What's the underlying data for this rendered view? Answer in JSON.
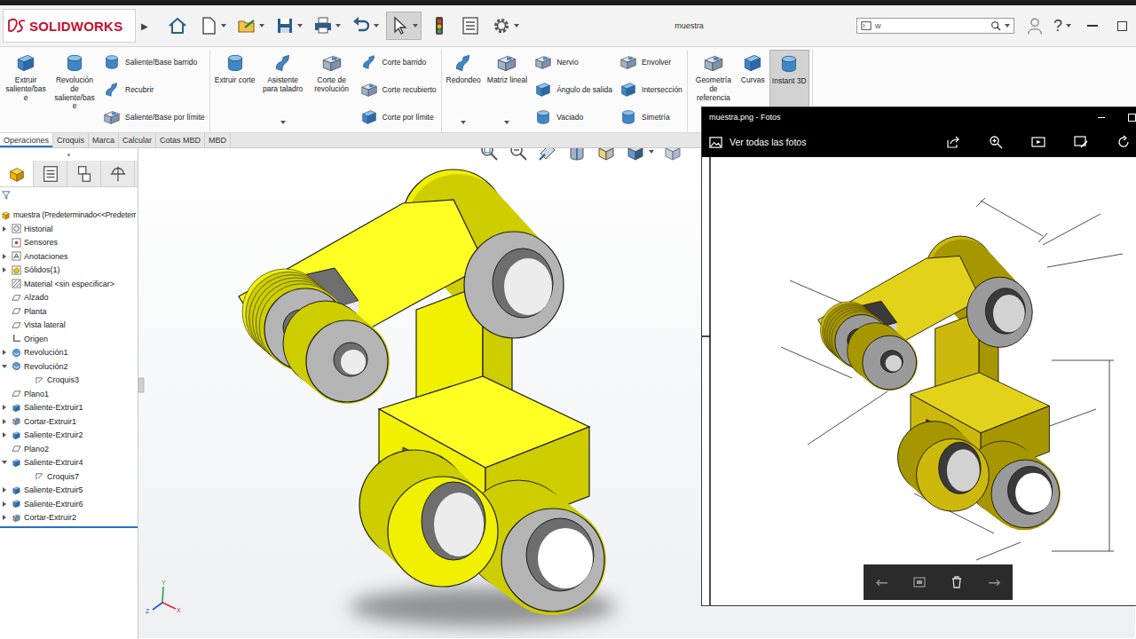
{
  "window": {
    "title": "muestra",
    "brand": "SOLIDWORKS",
    "menu_arrow": "▶"
  },
  "quick_access": [
    {
      "selected": false
    },
    {
      "selected": false
    },
    {
      "selected": false
    },
    {
      "selected": false
    },
    {
      "selected": false
    },
    {
      "selected": false
    },
    {
      "selected": true
    },
    {
      "selected": false
    },
    {
      "selected": false
    },
    {
      "selected": false
    }
  ],
  "search": {
    "value": "w"
  },
  "help": "?",
  "ribbon": {
    "groups": [
      {
        "items": [
          {
            "kind": "large",
            "label": "Extruir saliente/base",
            "selected": false,
            "dropdown": false
          },
          {
            "kind": "large",
            "label": "Revolución de saliente/base",
            "selected": false,
            "dropdown": false
          },
          {
            "kind": "stack",
            "buttons": [
              {
                "label": "Saliente/Base barrido",
                "selected": false
              },
              {
                "label": "Recubrir",
                "selected": false
              },
              {
                "label": "Saliente/Base por límite",
                "selected": false
              }
            ]
          }
        ]
      },
      {
        "items": [
          {
            "kind": "large",
            "label": "Extruir corte",
            "selected": false,
            "dropdown": false
          },
          {
            "kind": "large",
            "label": "Asistente para taladro",
            "selected": false,
            "dropdown": true
          },
          {
            "kind": "large",
            "label": "Corte de revolución",
            "selected": false,
            "dropdown": false
          },
          {
            "kind": "stack",
            "buttons": [
              {
                "label": "Corte barrido",
                "selected": false
              },
              {
                "label": "Corte recubierto",
                "selected": false
              },
              {
                "label": "Corte por límite",
                "selected": false
              }
            ]
          }
        ]
      },
      {
        "items": [
          {
            "kind": "large",
            "label": "Redondeo",
            "selected": false,
            "dropdown": true
          },
          {
            "kind": "large",
            "label": "Matriz lineal",
            "selected": false,
            "dropdown": true
          },
          {
            "kind": "stack",
            "buttons": [
              {
                "label": "Nervio",
                "selected": false
              },
              {
                "label": "Ángulo de salida",
                "selected": false
              },
              {
                "label": "Vaciado",
                "selected": false
              }
            ]
          },
          {
            "kind": "stack",
            "buttons": [
              {
                "label": "Envolver",
                "selected": false
              },
              {
                "label": "Intersección",
                "selected": false
              },
              {
                "label": "Simetría",
                "selected": false
              }
            ]
          }
        ]
      },
      {
        "items": [
          {
            "kind": "large",
            "label": "Geometría de referencia",
            "selected": false,
            "dropdown": true
          },
          {
            "kind": "large",
            "label": "Curvas",
            "selected": false,
            "dropdown": false
          },
          {
            "kind": "large",
            "label": "Instant 3D",
            "selected": true,
            "dropdown": false
          }
        ]
      }
    ]
  },
  "command_tabs": [
    {
      "label": "Operaciones",
      "selected": true
    },
    {
      "label": "Croquis",
      "selected": false
    },
    {
      "label": "Marca",
      "selected": false
    },
    {
      "label": "Calcular",
      "selected": false
    },
    {
      "label": "Cotas MBD",
      "selected": false
    },
    {
      "label": "MBD",
      "selected": false
    }
  ],
  "feature_tabs": [
    {
      "selected": true
    },
    {
      "selected": false
    },
    {
      "selected": false
    },
    {
      "selected": false
    }
  ],
  "tree": {
    "root": "muestra  (Predeterminado<<Predeterr",
    "items": [
      {
        "label": "Historial",
        "kind": "history",
        "expandable": true,
        "expanded": false,
        "indented": false
      },
      {
        "label": "Sensores",
        "kind": "sensor",
        "expandable": false,
        "expanded": false,
        "indented": false
      },
      {
        "label": "Anotaciones",
        "kind": "annotation",
        "expandable": true,
        "expanded": false,
        "indented": false
      },
      {
        "label": "Sólidos(1)",
        "kind": "solids",
        "expandable": true,
        "expanded": false,
        "indented": false
      },
      {
        "label": "Material <sin especificar>",
        "kind": "material",
        "expandable": false,
        "expanded": false,
        "indented": false
      },
      {
        "label": "Alzado",
        "kind": "plane",
        "expandable": false,
        "expanded": false,
        "indented": false
      },
      {
        "label": "Planta",
        "kind": "plane",
        "expandable": false,
        "expanded": false,
        "indented": false
      },
      {
        "label": "Vista lateral",
        "kind": "plane",
        "expandable": false,
        "expanded": false,
        "indented": false
      },
      {
        "label": "Origen",
        "kind": "origin",
        "expandable": false,
        "expanded": false,
        "indented": false
      },
      {
        "label": "Revolución1",
        "kind": "revolve",
        "expandable": true,
        "expanded": false,
        "indented": false
      },
      {
        "label": "Revolución2",
        "kind": "revolve",
        "expandable": true,
        "expanded": true,
        "indented": false
      },
      {
        "label": "Croquis3",
        "kind": "sketch",
        "expandable": false,
        "expanded": false,
        "indented": true
      },
      {
        "label": "Plano1",
        "kind": "plane",
        "expandable": false,
        "expanded": false,
        "indented": false
      },
      {
        "label": "Saliente-Extruir1",
        "kind": "extrude",
        "expandable": true,
        "expanded": false,
        "indented": false
      },
      {
        "label": "Cortar-Extruir1",
        "kind": "cut",
        "expandable": true,
        "expanded": false,
        "indented": false
      },
      {
        "label": "Saliente-Extruir2",
        "kind": "extrude",
        "expandable": true,
        "expanded": false,
        "indented": false
      },
      {
        "label": "Plano2",
        "kind": "plane",
        "expandable": false,
        "expanded": false,
        "indented": false
      },
      {
        "label": "Saliente-Extruir4",
        "kind": "extrude",
        "expandable": true,
        "expanded": true,
        "indented": false
      },
      {
        "label": "Croquis7",
        "kind": "sketch",
        "expandable": false,
        "expanded": false,
        "indented": true
      },
      {
        "label": "Saliente-Extruir5",
        "kind": "extrude",
        "expandable": true,
        "expanded": false,
        "indented": false
      },
      {
        "label": "Saliente-Extruir6",
        "kind": "extrude",
        "expandable": true,
        "expanded": false,
        "indented": false
      },
      {
        "label": "Cortar-Extruir2",
        "kind": "cut",
        "expandable": true,
        "expanded": false,
        "indented": false
      }
    ]
  },
  "triad": {
    "x": "X",
    "y": "Y",
    "z": "Z"
  },
  "photos": {
    "title": "muestra.png - Fotos",
    "toolbar_label": "Ver todas las fotos",
    "nav": {
      "previous": "←",
      "next": "→"
    }
  }
}
